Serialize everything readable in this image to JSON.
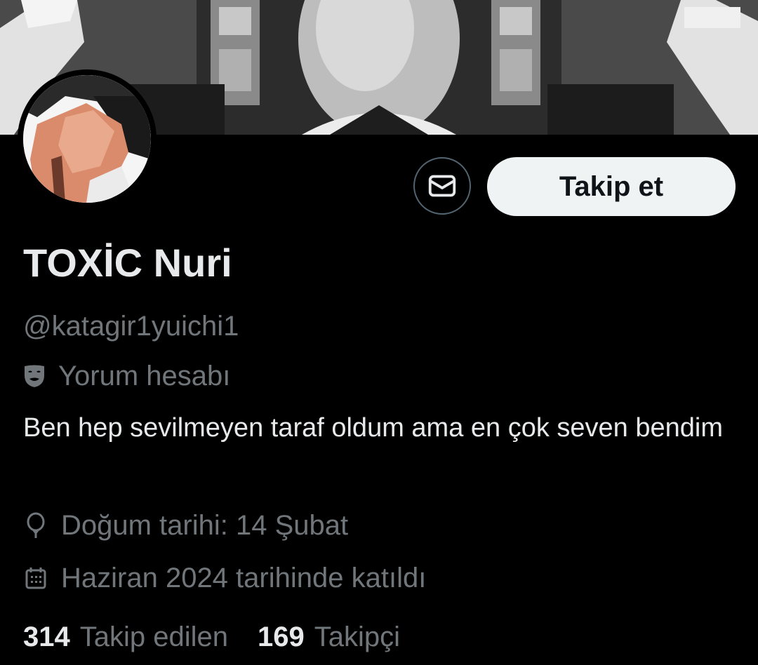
{
  "profile": {
    "display_name": "TOXİC Nuri",
    "handle": "@katagir1yuichi1",
    "label": "Yorum hesabı",
    "bio": "Ben hep sevilmeyen taraf oldum ama en çok seven bendim",
    "birthday": "Doğum tarihi: 14 Şubat",
    "joined": "Haziran 2024 tarihinde katıldı"
  },
  "actions": {
    "message_icon": "envelope-icon",
    "follow_label": "Takip et"
  },
  "stats": {
    "following_count": "314",
    "following_label": "Takip edilen",
    "followers_count": "169",
    "followers_label": "Takipçi"
  },
  "icons": {
    "label": "mask-icon",
    "birthday": "balloon-icon",
    "joined": "calendar-icon"
  },
  "colors": {
    "background": "#000000",
    "primary_text": "#e7e9ea",
    "secondary_text": "#71767b",
    "follow_button_bg": "#eff3f4",
    "follow_button_text": "#0f1419",
    "border": "#536471"
  }
}
